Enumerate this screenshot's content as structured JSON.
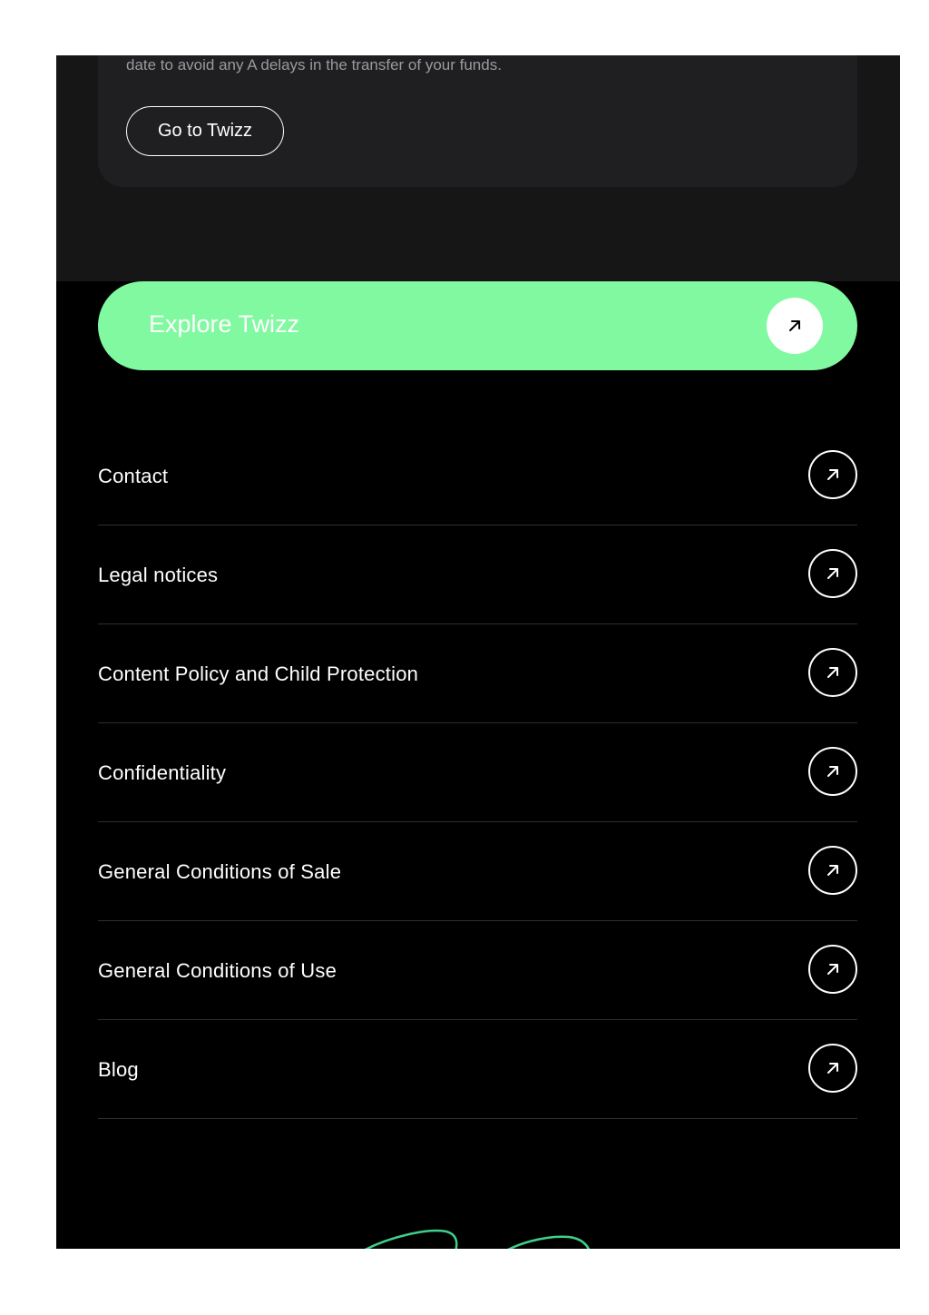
{
  "card": {
    "text": "date to avoid any A delays in the transfer of your funds.",
    "button_label": "Go to Twizz"
  },
  "explore": {
    "label": "Explore Twizz",
    "icon": "arrow-up-right-icon",
    "color": "#80f9a0"
  },
  "links": [
    {
      "label": "Contact",
      "icon": "arrow-up-right-icon"
    },
    {
      "label": "Legal notices",
      "icon": "arrow-up-right-icon"
    },
    {
      "label": "Content Policy and Child Protection",
      "icon": "arrow-up-right-icon"
    },
    {
      "label": "Confidentiality",
      "icon": "arrow-up-right-icon"
    },
    {
      "label": "General Conditions of Sale",
      "icon": "arrow-up-right-icon"
    },
    {
      "label": "General Conditions of Use",
      "icon": "arrow-up-right-icon"
    },
    {
      "label": "Blog",
      "icon": "arrow-up-right-icon"
    }
  ],
  "colors": {
    "accent": "#80f9a0",
    "background": "#000000",
    "card": "#1f1f21",
    "logo_stroke": "#3fcf8a"
  },
  "logo": {
    "icon": "twizz-logo-icon"
  }
}
